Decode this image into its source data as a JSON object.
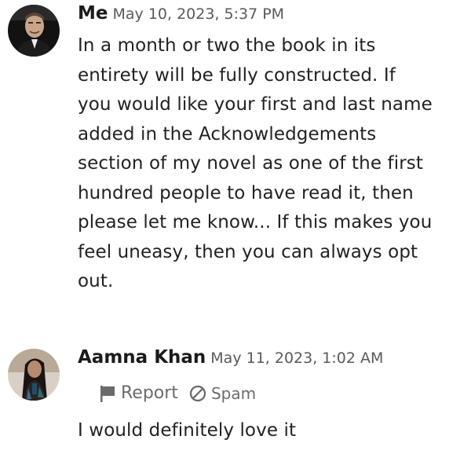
{
  "comments": [
    {
      "author": "Me",
      "timestamp": "May 10, 2023, 5:37 PM",
      "avatar_icon": "user-avatar-man-icon",
      "lines": [
        "In a month or two the book in its",
        "entirety will be fully constructed. If",
        "you would like your first and last name",
        "added in the Acknowledgements",
        "section of my novel as one of the first",
        "hundred people to have read it, then",
        "please let me know... If this makes you",
        "feel uneasy, then you can always opt",
        "out."
      ]
    },
    {
      "author": "Aamna Khan",
      "timestamp": "May 11, 2023, 1:02 AM",
      "avatar_icon": "user-avatar-woman-icon",
      "actions": {
        "report_label": "Report",
        "report_icon": "flag-icon",
        "spam_label": "Spam",
        "spam_icon": "prohibited-icon"
      },
      "text": "I would definitely love it"
    }
  ],
  "colors": {
    "text": "#222222",
    "muted": "#6b6b6b",
    "timestamp": "#5a5a5a"
  }
}
